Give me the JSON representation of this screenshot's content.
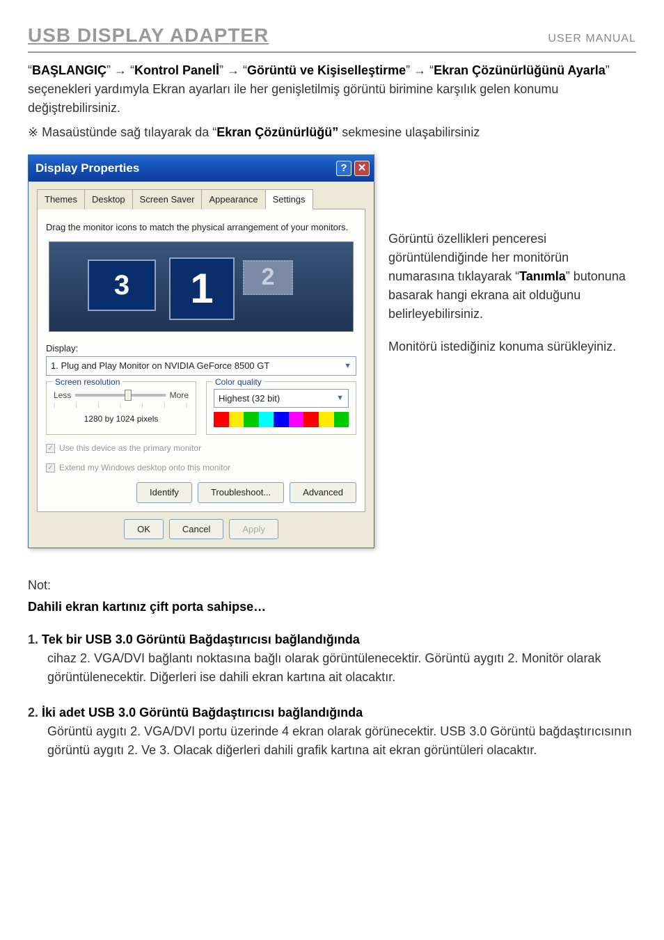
{
  "header": {
    "title": "USB DISPLAY ADAPTER",
    "subtitle": "USER MANUAL"
  },
  "breadcrumb": {
    "prefix": "“",
    "b1": "BAŞLANGIÇ",
    "sep": "” → “",
    "b2": "Kontrol Panelİ",
    "b3": "Görüntü ve Kişiselleştirme",
    "b4": "Ekran Çözünürlüğünü Ayarla",
    "suffix": "” seçenekleri yardımyla Ekran ayarları ile her genişletilmiş görüntü birimine karşılık gelen konumu değiştrebilirsiniz."
  },
  "tip": {
    "mark": "※ ",
    "pre": "Masaüstünde sağ tılayarak da “",
    "bold": "Ekran Çözünürlüğü”",
    "post": " sekmesine ulaşabilirsiniz"
  },
  "dialog": {
    "title": "Display Properties",
    "tabs": {
      "themes": "Themes",
      "desktop": "Desktop",
      "ss": "Screen Saver",
      "appearance": "Appearance",
      "settings": "Settings"
    },
    "instruction": "Drag the monitor icons to match the physical arrangement of your monitors.",
    "monitors": {
      "m1": "1",
      "m2": "2",
      "m3": "3"
    },
    "display_label": "Display:",
    "display_value": "1. Plug and Play Monitor on NVIDIA GeForce 8500 GT",
    "sr": {
      "legend": "Screen resolution",
      "less": "Less",
      "more": "More",
      "value": "1280 by 1024 pixels"
    },
    "cq": {
      "legend": "Color quality",
      "value": "Highest (32 bit)"
    },
    "chk1": "Use this device as the primary monitor",
    "chk2": "Extend my Windows desktop onto this monitor",
    "btn": {
      "identify": "Identify",
      "troubleshoot": "Troubleshoot...",
      "advanced": "Advanced",
      "ok": "OK",
      "cancel": "Cancel",
      "apply": "Apply"
    }
  },
  "side": {
    "p1a": "Görüntü özellikleri penceresi görüntülendiğinde her monitörün numarasına tıklayarak “",
    "p1b": "Tanımla",
    "p1c": "” butonuna basarak hangi ekrana ait olduğunu belirleyebilirsiniz.",
    "p2": "Monitörü istediğiniz konuma sürükleyiniz."
  },
  "note": {
    "heading": "Not:",
    "sub": "Dahili ekran kartınız çift porta sahipse…",
    "i1": {
      "n": "1.",
      "t": "Tek bir USB 3.0 Görüntü Bağdaştırıcısı bağlandığında",
      "b": "cihaz 2. VGA/DVI bağlantı noktasına bağlı olarak görüntülenecektir. Görüntü aygıtı 2. Monitör olarak görüntülenecektir. Diğerleri ise dahili ekran kartına ait olacaktır."
    },
    "i2": {
      "n": "2.",
      "t": "İki adet USB 3.0 Görüntü Bağdaştırıcısı bağlandığında",
      "b": "Görüntü aygıtı 2. VGA/DVI portu üzerinde 4 ekran olarak görünecektir. USB 3.0 Görüntü bağdaştırıcısının görüntü aygıtı 2. Ve 3. Olacak diğerleri dahili grafik kartına ait ekran görüntüleri olacaktır."
    }
  }
}
